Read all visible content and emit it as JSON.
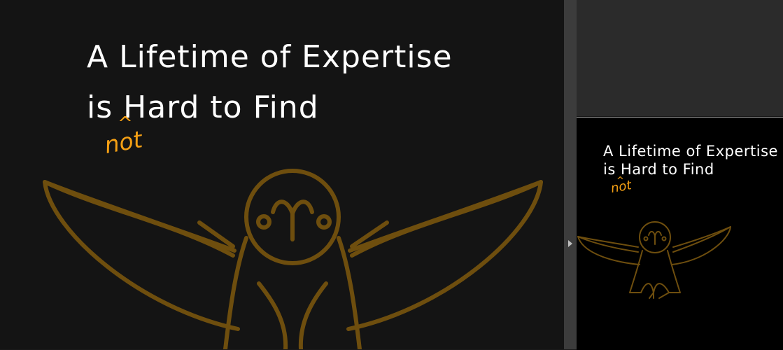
{
  "slide": {
    "headline_line1": "A Lifetime of Expertise",
    "headline_line2": "is Hard to Find",
    "insert_caret": "^",
    "handwritten_insert": "not"
  },
  "thumbnail": {
    "headline_line1": "A Lifetime of Expertise",
    "headline_line2": "is Hard to Find",
    "insert_caret": "^",
    "handwritten_insert": "not"
  },
  "icons": {
    "owl": "owl-with-spread-wings-icon",
    "expand": "expand-arrow-icon"
  },
  "colors": {
    "slide_background": "#141414",
    "thumbnail_background": "#000000",
    "headline_text": "#ffffff",
    "handwriting_accent": "#f5a014",
    "owl_stroke": "#6e4e0e",
    "panel_background": "#2b2b2b",
    "divider": "#3c3c3c"
  }
}
